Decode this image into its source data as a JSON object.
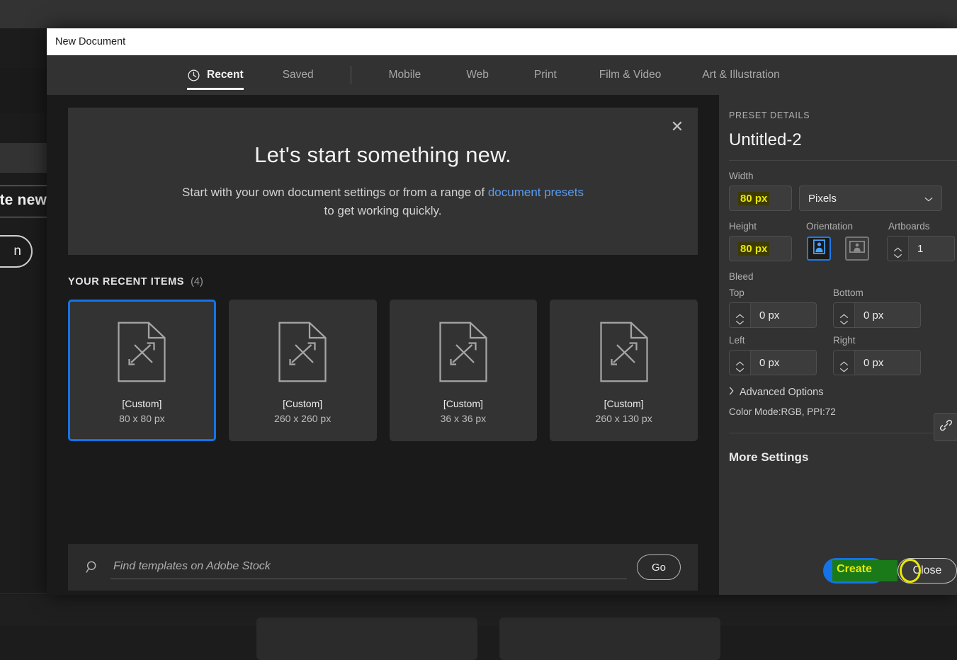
{
  "background_app": {
    "create_new_label": "te new",
    "pill_label": "n"
  },
  "dialog": {
    "title": "New Document",
    "tabs": [
      {
        "label": "Recent",
        "icon": "clock-icon",
        "active": true
      },
      {
        "label": "Saved",
        "active": false
      },
      {
        "label": "Mobile",
        "active": false
      },
      {
        "label": "Web",
        "active": false
      },
      {
        "label": "Print",
        "active": false
      },
      {
        "label": "Film & Video",
        "active": false
      },
      {
        "label": "Art & Illustration",
        "active": false
      }
    ],
    "hero": {
      "close_icon": "close-icon",
      "title": "Let's start something new.",
      "subtitle_before": "Start with your own document settings or from a range of ",
      "link_text": "document presets",
      "subtitle_after": "to get working quickly."
    },
    "recent": {
      "heading": "YOUR RECENT ITEMS",
      "count": "(4)",
      "items": [
        {
          "name": "[Custom]",
          "size": "80 x 80 px",
          "selected": true
        },
        {
          "name": "[Custom]",
          "size": "260 x 260 px",
          "selected": false
        },
        {
          "name": "[Custom]",
          "size": "36 x 36 px",
          "selected": false
        },
        {
          "name": "[Custom]",
          "size": "260 x 130 px",
          "selected": false
        }
      ]
    },
    "search": {
      "icon": "search-icon",
      "placeholder": "Find templates on Adobe Stock",
      "value": "",
      "go_label": "Go"
    },
    "preset": {
      "section_label": "PRESET DETAILS",
      "name": "Untitled-2",
      "width_label": "Width",
      "width_value": "80 px",
      "units_value": "Pixels",
      "height_label": "Height",
      "height_value": "80 px",
      "orientation_label": "Orientation",
      "orientation_portrait_icon": "portrait-orientation-icon",
      "orientation_landscape_icon": "landscape-orientation-icon",
      "artboards_label": "Artboards",
      "artboards_value": "1",
      "bleed_label": "Bleed",
      "bleed_top_label": "Top",
      "bleed_top_value": "0 px",
      "bleed_bottom_label": "Bottom",
      "bleed_bottom_value": "0 px",
      "bleed_left_label": "Left",
      "bleed_left_value": "0 px",
      "bleed_right_label": "Right",
      "bleed_right_value": "0 px",
      "link_icon": "link-icon",
      "advanced_label": "Advanced Options",
      "color_mode_text": "Color Mode:RGB, PPI:72",
      "more_settings_label": "More Settings"
    },
    "actions": {
      "create_label": "Create",
      "close_label": "Close"
    }
  },
  "colors": {
    "accent_blue": "#1473e6",
    "highlight_yellow": "#eaea00",
    "highlight_green": "#1a7a1a",
    "link_blue": "#5a9bf0",
    "panel_bg": "#323232",
    "content_bg": "#1a1a1a"
  }
}
